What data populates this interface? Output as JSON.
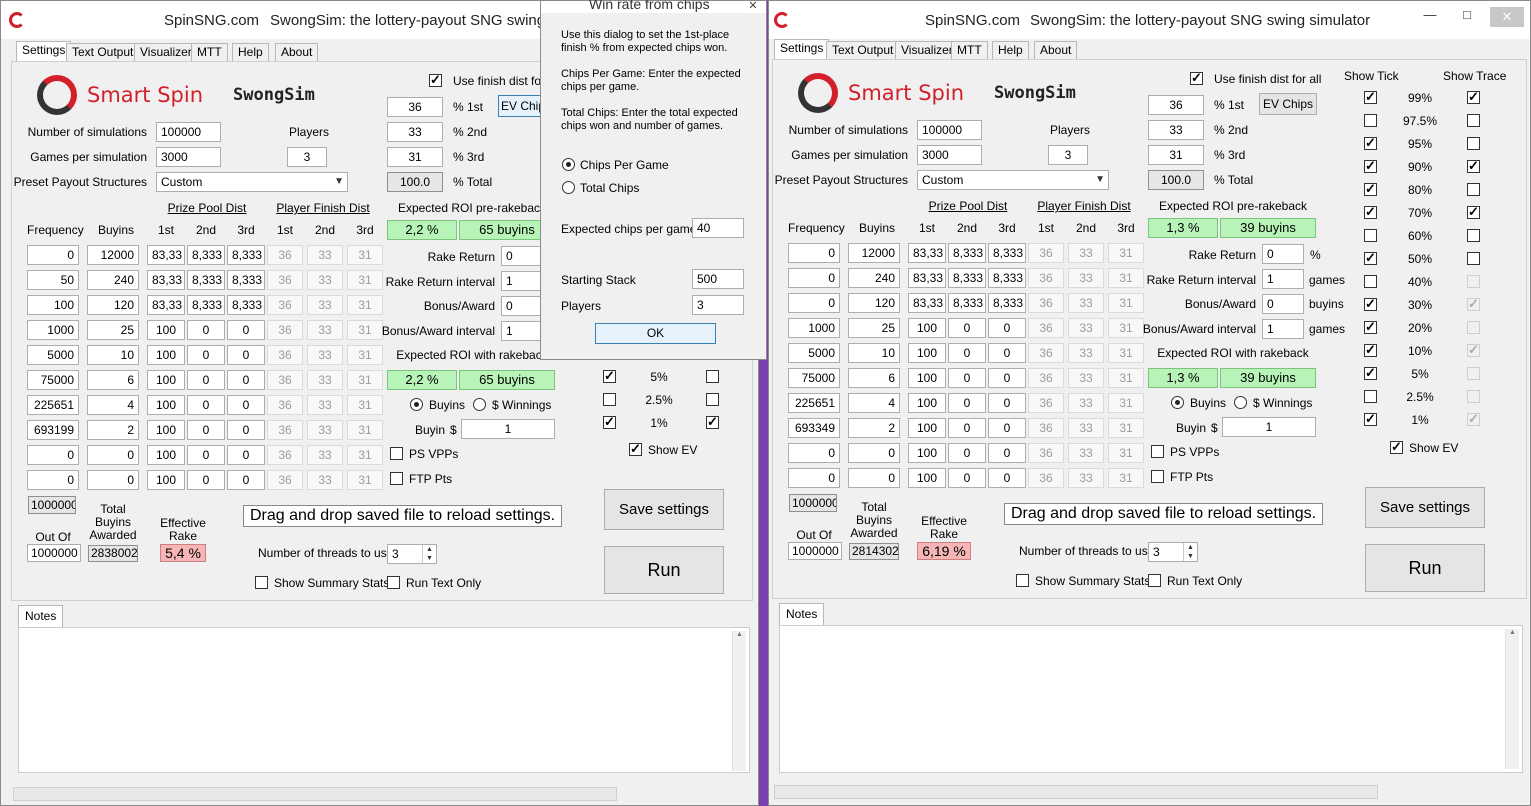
{
  "left": {
    "title_site": "SpinSNG.com",
    "title_app": "SwongSim: the lottery-payout SNG swing",
    "tabs": [
      "Settings",
      "Text Output",
      "Visualizer",
      "MTT",
      "Help",
      "About"
    ],
    "logo_brand": "Smart Spin",
    "logo_app": "SwongSim",
    "use_finish_dist": "Use finish dist for a",
    "ev_chips_label": "EV Chip",
    "num_sims_label": "Number of simulations",
    "num_sims": "100000",
    "players_label": "Players",
    "games_label": "Games per simulation",
    "games": "3000",
    "players": "3",
    "preset_label": "Preset Payout Structures",
    "preset": "Custom",
    "pct": {
      "p1": "36",
      "p1_label": "% 1st",
      "p2": "33",
      "p2_label": "% 2nd",
      "p3": "31",
      "p3_label": "% 3rd",
      "total": "100.0",
      "total_label": "% Total"
    },
    "headers": {
      "frequency": "Frequency",
      "buyins": "Buyins",
      "prize_pool": "Prize Pool Dist",
      "finish": "Player Finish Dist",
      "c1": "1st",
      "c2": "2nd",
      "c3": "3rd"
    },
    "rows": [
      {
        "freq": "0",
        "buy": "12000",
        "p1": "83,33",
        "p2": "8,333",
        "p3": "8,333",
        "f1": "36",
        "f2": "33",
        "f3": "31"
      },
      {
        "freq": "50",
        "buy": "240",
        "p1": "83,33",
        "p2": "8,333",
        "p3": "8,333",
        "f1": "36",
        "f2": "33",
        "f3": "31"
      },
      {
        "freq": "100",
        "buy": "120",
        "p1": "83,33",
        "p2": "8,333",
        "p3": "8,333",
        "f1": "36",
        "f2": "33",
        "f3": "31"
      },
      {
        "freq": "1000",
        "buy": "25",
        "p1": "100",
        "p2": "0",
        "p3": "0",
        "f1": "36",
        "f2": "33",
        "f3": "31"
      },
      {
        "freq": "5000",
        "buy": "10",
        "p1": "100",
        "p2": "0",
        "p3": "0",
        "f1": "36",
        "f2": "33",
        "f3": "31"
      },
      {
        "freq": "75000",
        "buy": "6",
        "p1": "100",
        "p2": "0",
        "p3": "0",
        "f1": "36",
        "f2": "33",
        "f3": "31"
      },
      {
        "freq": "225651",
        "buy": "4",
        "p1": "100",
        "p2": "0",
        "p3": "0",
        "f1": "36",
        "f2": "33",
        "f3": "31"
      },
      {
        "freq": "693199",
        "buy": "2",
        "p1": "100",
        "p2": "0",
        "p3": "0",
        "f1": "36",
        "f2": "33",
        "f3": "31"
      },
      {
        "freq": "0",
        "buy": "0",
        "p1": "100",
        "p2": "0",
        "p3": "0",
        "f1": "36",
        "f2": "33",
        "f3": "31"
      },
      {
        "freq": "0",
        "buy": "0",
        "p1": "100",
        "p2": "0",
        "p3": "0",
        "f1": "36",
        "f2": "33",
        "f3": "31"
      }
    ],
    "roi_pre_label": "Expected ROI pre-rakeback",
    "roi_pre_pct": "2,2 %",
    "roi_pre_buyins": "65 buyins",
    "rake_return_label": "Rake Return",
    "rake_return": "0",
    "rake_interval_label": "Rake Return interval",
    "rake_interval": "1",
    "bonus_label": "Bonus/Award",
    "bonus": "0",
    "bonus_interval_label": "Bonus/Award interval",
    "bonus_interval": "1",
    "roi_rb_label": "Expected ROI with rakeback",
    "roi_rb_pct": "2,2 %",
    "roi_rb_buyins": "65 buyins",
    "radio_buyins": "Buyins",
    "radio_winnings": "$ Winnings",
    "buyin_label": "Buyin",
    "buyin_dollar": "$",
    "buyin": "1",
    "ps_vpps": "PS VPPs",
    "ftp_pts": "FTP Pts",
    "sum_freq": "1000000",
    "out_of_label": "Out Of",
    "out_of": "1000000",
    "total_buyins_label": "Total\nBuyins\nAwarded",
    "total_buyins": "2838002",
    "eff_rake_label": "Effective\nRake",
    "eff_rake": "5,4 %",
    "drag_text": "Drag and drop saved file to reload settings.",
    "threads_label": "Number of threads to use",
    "threads": "3",
    "show_summary": "Show Summary Stats",
    "run_text_only": "Run Text Only",
    "save_btn": "Save settings",
    "run_btn": "Run",
    "notes_tab": "Notes",
    "tick_rows": [
      {
        "label": "5%",
        "tick": true,
        "trace": false
      },
      {
        "label": "2.5%",
        "tick": false,
        "trace": false
      },
      {
        "label": "1%",
        "tick": true,
        "trace": true
      }
    ],
    "show_ev": "Show EV"
  },
  "dialog": {
    "title": "Win rate from chips",
    "intro": "Use this dialog to set the 1st-place finish % from expected chips won.",
    "cpg_help": "Chips Per Game:  Enter the expected chips per game.",
    "tc_help": "Total Chips:  Enter the total expected chips won and number of games.",
    "radio_cpg": "Chips Per Game",
    "radio_tc": "Total Chips",
    "exp_chips_label": "Expected chips per game",
    "exp_chips": "40",
    "stack_label": "Starting Stack",
    "stack": "500",
    "players_label": "Players",
    "players": "3",
    "ok": "OK"
  },
  "right": {
    "title_site": "SpinSNG.com",
    "title_app": "SwongSim: the lottery-payout SNG swing simulator",
    "tabs": [
      "Settings",
      "Text Output",
      "Visualizer",
      "MTT",
      "Help",
      "About"
    ],
    "logo_brand": "Smart Spin",
    "logo_app": "SwongSim",
    "use_finish_dist": "Use finish dist for all",
    "ev_chips_label": "EV Chips",
    "num_sims_label": "Number of simulations",
    "num_sims": "100000",
    "players_label": "Players",
    "games_label": "Games per simulation",
    "games": "3000",
    "players": "3",
    "preset_label": "Preset Payout Structures",
    "preset": "Custom",
    "pct": {
      "p1": "36",
      "p1_label": "% 1st",
      "p2": "33",
      "p2_label": "% 2nd",
      "p3": "31",
      "p3_label": "% 3rd",
      "total": "100.0",
      "total_label": "% Total"
    },
    "headers": {
      "frequency": "Frequency",
      "buyins": "Buyins",
      "prize_pool": "Prize Pool Dist",
      "finish": "Player Finish Dist",
      "c1": "1st",
      "c2": "2nd",
      "c3": "3rd"
    },
    "rows": [
      {
        "freq": "0",
        "buy": "12000",
        "p1": "83,33",
        "p2": "8,333",
        "p3": "8,333",
        "f1": "36",
        "f2": "33",
        "f3": "31"
      },
      {
        "freq": "0",
        "buy": "240",
        "p1": "83,33",
        "p2": "8,333",
        "p3": "8,333",
        "f1": "36",
        "f2": "33",
        "f3": "31"
      },
      {
        "freq": "0",
        "buy": "120",
        "p1": "83,33",
        "p2": "8,333",
        "p3": "8,333",
        "f1": "36",
        "f2": "33",
        "f3": "31"
      },
      {
        "freq": "1000",
        "buy": "25",
        "p1": "100",
        "p2": "0",
        "p3": "0",
        "f1": "36",
        "f2": "33",
        "f3": "31"
      },
      {
        "freq": "5000",
        "buy": "10",
        "p1": "100",
        "p2": "0",
        "p3": "0",
        "f1": "36",
        "f2": "33",
        "f3": "31"
      },
      {
        "freq": "75000",
        "buy": "6",
        "p1": "100",
        "p2": "0",
        "p3": "0",
        "f1": "36",
        "f2": "33",
        "f3": "31"
      },
      {
        "freq": "225651",
        "buy": "4",
        "p1": "100",
        "p2": "0",
        "p3": "0",
        "f1": "36",
        "f2": "33",
        "f3": "31"
      },
      {
        "freq": "693349",
        "buy": "2",
        "p1": "100",
        "p2": "0",
        "p3": "0",
        "f1": "36",
        "f2": "33",
        "f3": "31"
      },
      {
        "freq": "0",
        "buy": "0",
        "p1": "100",
        "p2": "0",
        "p3": "0",
        "f1": "36",
        "f2": "33",
        "f3": "31"
      },
      {
        "freq": "0",
        "buy": "0",
        "p1": "100",
        "p2": "0",
        "p3": "0",
        "f1": "36",
        "f2": "33",
        "f3": "31"
      }
    ],
    "roi_pre_label": "Expected ROI pre-rakeback",
    "roi_pre_pct": "1,3 %",
    "roi_pre_buyins": "39 buyins",
    "rake_return_label": "Rake Return",
    "rake_return": "0",
    "rake_unit": "%",
    "rake_interval_label": "Rake Return interval",
    "rake_interval": "1",
    "rake_interval_unit": "games",
    "bonus_label": "Bonus/Award",
    "bonus": "0",
    "bonus_unit": "buyins",
    "bonus_interval_label": "Bonus/Award interval",
    "bonus_interval": "1",
    "bonus_interval_unit": "games",
    "roi_rb_label": "Expected ROI with rakeback",
    "roi_rb_pct": "1,3 %",
    "roi_rb_buyins": "39 buyins",
    "radio_buyins": "Buyins",
    "radio_winnings": "$ Winnings",
    "buyin_label": "Buyin",
    "buyin_dollar": "$",
    "buyin": "1",
    "ps_vpps": "PS VPPs",
    "ftp_pts": "FTP Pts",
    "sum_freq": "1000000",
    "out_of_label": "Out Of",
    "out_of": "1000000",
    "total_buyins_label": "Total\nBuyins\nAwarded",
    "total_buyins": "2814302",
    "eff_rake_label": "Effective\nRake",
    "eff_rake": "6,19 %",
    "drag_text": "Drag and drop saved file to reload settings.",
    "threads_label": "Number of threads to use",
    "threads": "3",
    "show_summary": "Show Summary Stats",
    "run_text_only": "Run Text Only",
    "save_btn": "Save settings",
    "run_btn": "Run",
    "notes_tab": "Notes",
    "show_tick_label": "Show Tick",
    "show_trace_label": "Show Trace",
    "tick_rows": [
      {
        "label": "99%",
        "tick": true,
        "trace": true,
        "trace_enabled": true
      },
      {
        "label": "97.5%",
        "tick": false,
        "trace": false,
        "trace_enabled": true
      },
      {
        "label": "95%",
        "tick": true,
        "trace": false,
        "trace_enabled": true
      },
      {
        "label": "90%",
        "tick": true,
        "trace": true,
        "trace_enabled": true
      },
      {
        "label": "80%",
        "tick": true,
        "trace": false,
        "trace_enabled": true
      },
      {
        "label": "70%",
        "tick": true,
        "trace": true,
        "trace_enabled": true
      },
      {
        "label": "60%",
        "tick": false,
        "trace": false,
        "trace_enabled": true
      },
      {
        "label": "50%",
        "tick": true,
        "trace": false,
        "trace_enabled": true
      },
      {
        "label": "40%",
        "tick": false,
        "trace": false,
        "trace_enabled": false
      },
      {
        "label": "30%",
        "tick": true,
        "trace": true,
        "trace_enabled": false
      },
      {
        "label": "20%",
        "tick": true,
        "trace": false,
        "trace_enabled": false
      },
      {
        "label": "10%",
        "tick": true,
        "trace": true,
        "trace_enabled": false
      },
      {
        "label": "5%",
        "tick": true,
        "trace": false,
        "trace_enabled": false
      },
      {
        "label": "2.5%",
        "tick": false,
        "trace": false,
        "trace_enabled": false
      },
      {
        "label": "1%",
        "tick": true,
        "trace": true,
        "trace_enabled": false
      }
    ],
    "show_ev": "Show EV"
  },
  "colors": {
    "green": "#b8f4b8",
    "pink": "#f6b6b6",
    "brand_red": "#d21f2a",
    "desktop": "#7a3fb0"
  }
}
